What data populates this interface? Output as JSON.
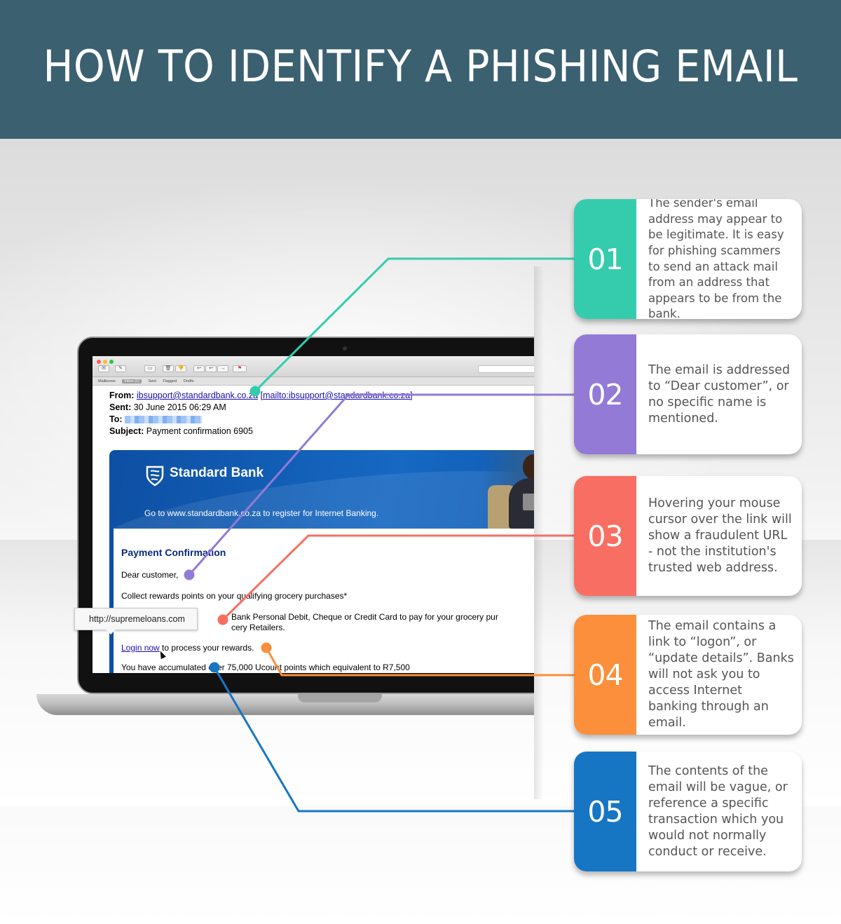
{
  "header": {
    "title": "HOW TO IDENTIFY A PHISHING EMAIL"
  },
  "mail": {
    "search_placeholder": "Se",
    "favorites": [
      "Mailboxes",
      "Inbox (1)",
      "Sent",
      "Flagged",
      "Drafts"
    ],
    "from_label": "From:",
    "from_address": "ibsupport@standardbank.co.za",
    "from_mailto": "[mailto:ibsupport@standardbank.co.za]",
    "sent_label": "Sent:",
    "sent_value": "30 June 2015 06:29 AM",
    "to_label": "To:",
    "subject_label": "Subject:",
    "subject_value": "Payment confirmation 6905"
  },
  "banner": {
    "brand": "Standard Bank",
    "text": "Go to www.standardbank.co.za to register for Internet Banking."
  },
  "email_body": {
    "title": "Payment Confirmation",
    "greeting": "Dear customer,",
    "line1": "Collect rewards points on your qualifying grocery purchases*",
    "line2a": "Bank Personal Debit, Cheque or Credit Card to pay for your grocery pur",
    "line2b": "cery Retailers.",
    "login_link": "Login now",
    "login_rest": " to process your rewards.",
    "line4": "You have accumulated over 75,000 Ucount points which equivalent to R7,500",
    "tooltip_url": "http://supremeloans.com"
  },
  "tips": [
    {
      "number": "01",
      "text": "The sender's email address may appear to be legitimate. It is easy for phishing scammers to send an attack mail from an address that appears to be from the bank.",
      "color": "#35ccae"
    },
    {
      "number": "02",
      "text": "The email is addressed to “Dear customer”, or no specific name is mentioned.",
      "color": "#927ad6"
    },
    {
      "number": "03",
      "text": "Hovering your mouse cursor over the link will show a fraudulent URL - not the institution's trusted web address.",
      "color": "#f96e62"
    },
    {
      "number": "04",
      "text": "The email contains a link to “logon”, or “update details”. Banks will not ask you to access Internet banking through an email.",
      "color": "#fb8f3b"
    },
    {
      "number": "05",
      "text": "The contents of the email will be vague, or reference a specific transaction which you would not normally conduct or receive.",
      "color": "#1676c4"
    }
  ]
}
